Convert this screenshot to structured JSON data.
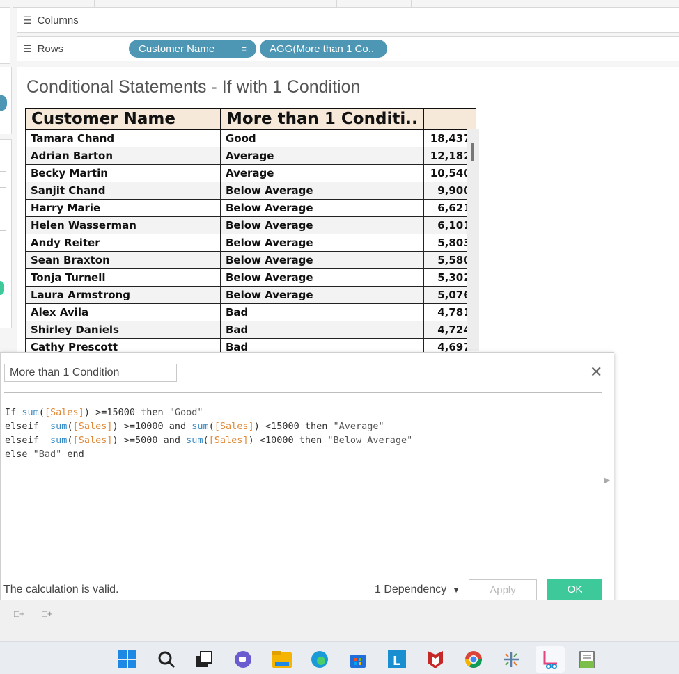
{
  "shelves": {
    "columns_label": "Columns",
    "rows_label": "Rows",
    "row_pills": [
      "Customer Name",
      "AGG(More than 1 Co.."
    ]
  },
  "view": {
    "title": "Conditional Statements - If with 1 Condition",
    "table": {
      "headers": [
        "Customer Name",
        "More than 1 Conditi..",
        ""
      ],
      "rows": [
        [
          "Tamara Chand",
          "Good",
          "18,437"
        ],
        [
          "Adrian Barton",
          "Average",
          "12,182"
        ],
        [
          "Becky Martin",
          "Average",
          "10,540"
        ],
        [
          "Sanjit Chand",
          "Below Average",
          "9,900"
        ],
        [
          "Harry Marie",
          "Below Average",
          "6,621"
        ],
        [
          "Helen Wasserman",
          "Below Average",
          "6,101"
        ],
        [
          "Andy Reiter",
          "Below Average",
          "5,803"
        ],
        [
          "Sean Braxton",
          "Below Average",
          "5,580"
        ],
        [
          "Tonja Turnell",
          "Below Average",
          "5,302"
        ],
        [
          "Laura Armstrong",
          "Below Average",
          "5,076"
        ],
        [
          "Alex Avila",
          "Bad",
          "4,781"
        ],
        [
          "Shirley Daniels",
          "Bad",
          "4,724"
        ],
        [
          "Cathy Prescott",
          "Bad",
          "4,697"
        ]
      ]
    }
  },
  "dialog": {
    "calc_name": "More than 1 Condition",
    "code": {
      "line1": {
        "a": "If ",
        "b": "sum",
        "c": "(",
        "d": "[Sales]",
        "e": ") >=15000 then ",
        "f": "\"Good\""
      },
      "line2": {
        "a": "elseif  ",
        "b": "sum",
        "c": "(",
        "d": "[Sales]",
        "e": ") >=10000 and ",
        "f": "sum",
        "g": "(",
        "h": "[Sales]",
        "i": ") <15000 then ",
        "j": "\"Average\""
      },
      "line3": {
        "a": "elseif  ",
        "b": "sum",
        "c": "(",
        "d": "[Sales]",
        "e": ") >=5000 and ",
        "f": "sum",
        "g": "(",
        "h": "[Sales]",
        "i": ") <10000 then ",
        "j": "\"Below Average\""
      },
      "line4": {
        "a": "else ",
        "b": "\"Bad\"",
        "c": " end"
      }
    },
    "status": "The calculation is valid.",
    "dependency": "1 Dependency",
    "apply_label": "Apply",
    "ok_label": "OK"
  },
  "colors": {
    "pill": "#4e97b4",
    "header_bg": "#f6e9d9",
    "ok_button": "#3dc99a",
    "function": "#3a8bc4",
    "field": "#e08a3a"
  },
  "taskbar": {
    "icons": [
      "windows-start-icon",
      "search-icon",
      "task-view-icon",
      "teams-chat-icon",
      "file-explorer-icon",
      "edge-icon",
      "store-icon",
      "l-app-icon",
      "mcafee-icon",
      "chrome-icon",
      "tableau-icon",
      "snipping-tool-icon",
      "notepad-icon"
    ]
  }
}
